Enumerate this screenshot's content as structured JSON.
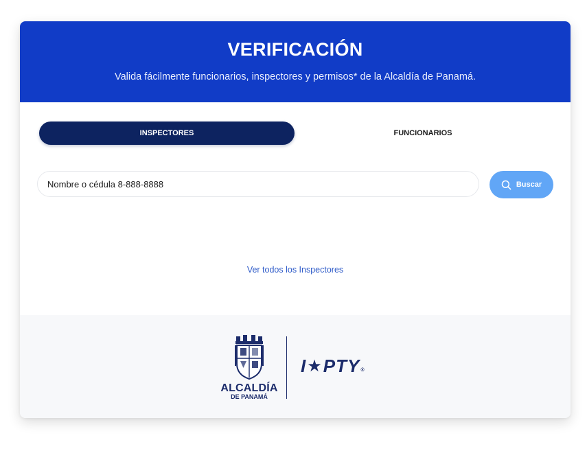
{
  "header": {
    "title": "VERIFICACIÓN",
    "subtitle": "Valida fácilmente funcionarios, inspectores y permisos* de la Alcaldía de Panamá."
  },
  "tabs": [
    {
      "label": "INSPECTORES",
      "active": true
    },
    {
      "label": "FUNCIONARIOS",
      "active": false
    }
  ],
  "search": {
    "placeholder": "Nombre o cédula 8-888-8888",
    "button_label": "Buscar",
    "icon": "search-icon"
  },
  "view_all_link": "Ver todos los Inspectores",
  "footer": {
    "logo_text": "ALCALDÍA",
    "logo_subtext": "DE PANAMÁ",
    "partner_logo": {
      "prefix": "I",
      "suffix": "PTY",
      "mark": "®"
    }
  },
  "colors": {
    "header_bg": "#113cc7",
    "active_tab_bg": "#0d2360",
    "search_button_bg": "#61a6f6",
    "link": "#2d5ac8",
    "footer_bg": "#f7f8fa",
    "brand_navy": "#1c2c6b"
  }
}
